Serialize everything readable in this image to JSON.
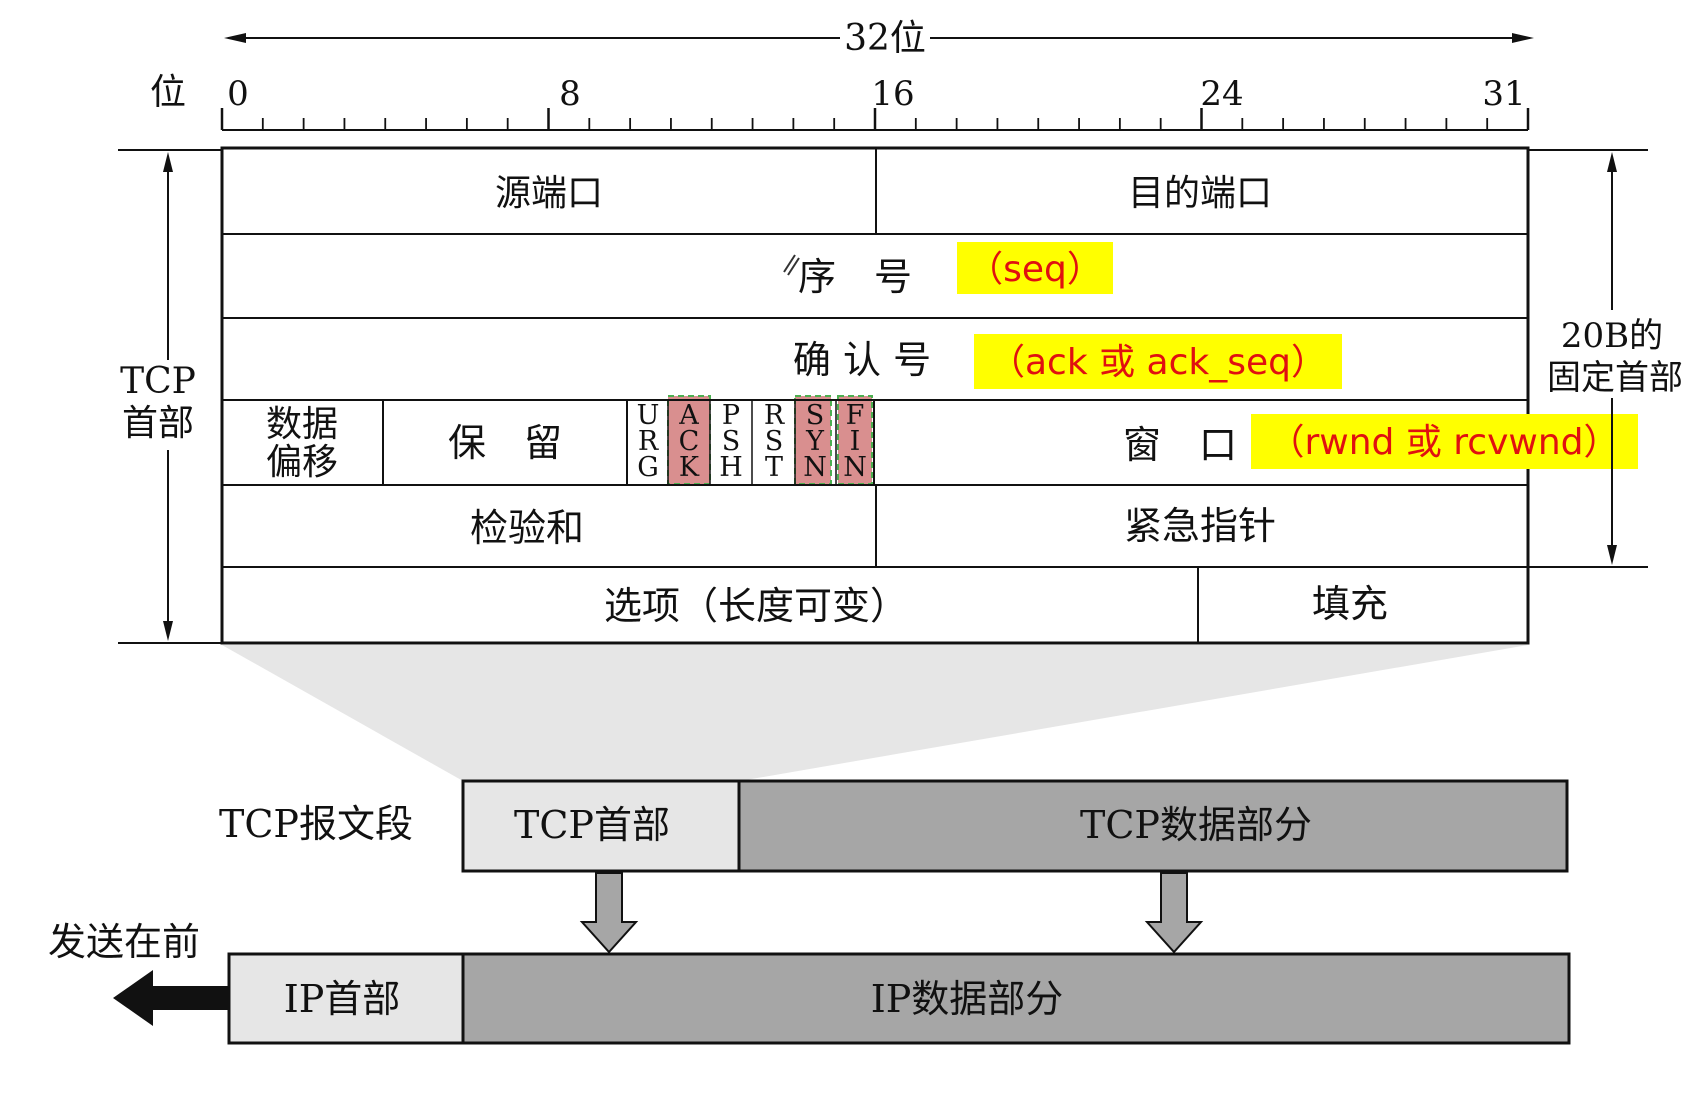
{
  "ruler": {
    "bits_label": "32位",
    "axis_label": "位",
    "ticks": [
      "0",
      "8",
      "16",
      "24",
      "31"
    ]
  },
  "header": {
    "row1": {
      "left": "源端口",
      "right": "目的端口"
    },
    "row2": {
      "label": "序　号",
      "annotation": "（seq）"
    },
    "row3": {
      "label": "确 认 号",
      "annotation": "（ack 或 ack_seq）"
    },
    "row4": {
      "offset_line1": "数据",
      "offset_line2": "偏移",
      "reserved": "保　留",
      "flags": [
        {
          "name": "URG",
          "letters": [
            "U",
            "R",
            "G"
          ],
          "highlighted": false
        },
        {
          "name": "ACK",
          "letters": [
            "A",
            "C",
            "K"
          ],
          "highlighted": true
        },
        {
          "name": "PSH",
          "letters": [
            "P",
            "S",
            "H"
          ],
          "highlighted": false
        },
        {
          "name": "RST",
          "letters": [
            "R",
            "S",
            "T"
          ],
          "highlighted": false
        },
        {
          "name": "SYN",
          "letters": [
            "S",
            "Y",
            "N"
          ],
          "highlighted": true
        },
        {
          "name": "FIN",
          "letters": [
            "F",
            "I",
            "N"
          ],
          "highlighted": true
        }
      ],
      "window": "窗　口",
      "annotation": "（rwnd 或 rcvwnd）"
    },
    "row5": {
      "left": "检验和",
      "right": "紧急指针"
    },
    "row6": {
      "left": "选项（长度可变）",
      "right": "填充"
    },
    "left_brace_line1": "TCP",
    "left_brace_line2": "首部",
    "right_brace_line1": "20B的",
    "right_brace_line2": "固定首部"
  },
  "segment": {
    "label": "TCP报文段",
    "header_label": "TCP首部",
    "data_label": "TCP数据部分"
  },
  "ip_packet": {
    "send_label": "发送在前",
    "header_label": "IP首部",
    "data_label": "IP数据部分"
  },
  "colors": {
    "highlight_yellow": "#ffff00",
    "annotation_red": "#e01010",
    "flag_highlight_fill": "#d98f8f",
    "flag_highlight_border": "#4caf50",
    "light_gray": "#e6e6e6",
    "dark_gray": "#a6a6a6"
  }
}
